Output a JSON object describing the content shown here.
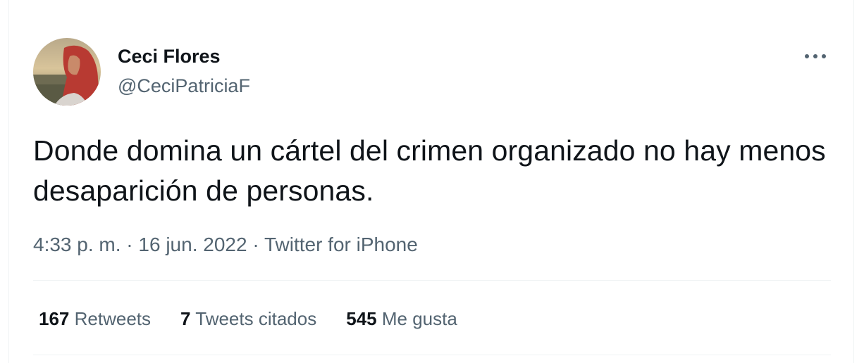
{
  "tweet": {
    "author_name": "Ceci Flores",
    "author_handle": "@CeciPatriciaF",
    "text": "Donde domina un cártel del crimen organizado no hay menos desaparición de personas.",
    "time": "4:33 p. m.",
    "separator": " · ",
    "date": "16 jun. 2022",
    "source": "Twitter for iPhone"
  },
  "stats": [
    {
      "count": "167",
      "label": "Retweets"
    },
    {
      "count": "7",
      "label": "Tweets citados"
    },
    {
      "count": "545",
      "label": "Me gusta"
    }
  ],
  "icons": {
    "avatar": "avatar-photo",
    "more": "more-options-icon"
  },
  "colors": {
    "text_primary": "#0f1419",
    "text_secondary": "#536471",
    "divider": "#eff3f4"
  }
}
